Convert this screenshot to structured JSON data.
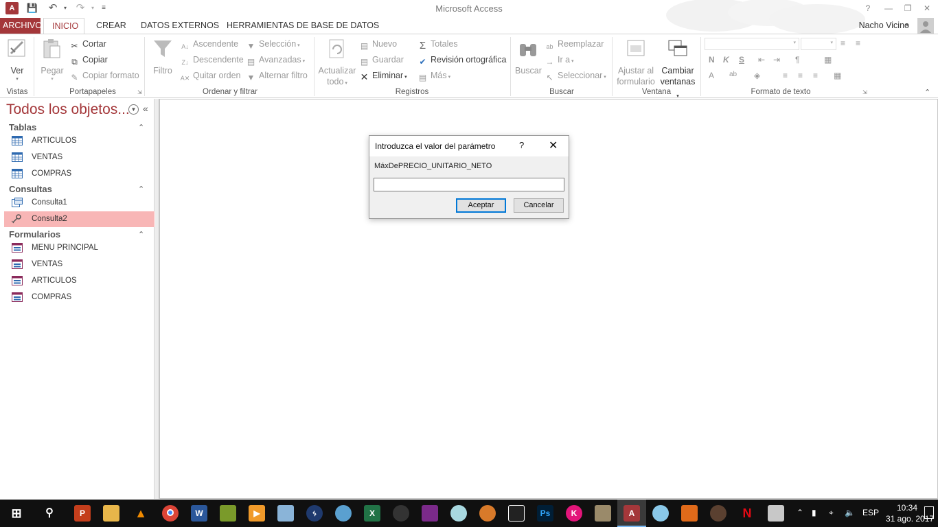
{
  "window": {
    "app_title": "Microsoft Access",
    "help_glyph": "?",
    "user": "Nacho Vicino",
    "app_logo": "A"
  },
  "tabs": [
    {
      "label": "ARCHIVO"
    },
    {
      "label": "INICIO"
    },
    {
      "label": "CREAR"
    },
    {
      "label": "DATOS EXTERNOS"
    },
    {
      "label": "HERRAMIENTAS DE BASE DE DATOS"
    }
  ],
  "ribbon": {
    "vistas": {
      "label": "Vistas",
      "ver": "Ver"
    },
    "portapapeles": {
      "label": "Portapapeles",
      "pegar": "Pegar",
      "cortar": "Cortar",
      "copiar": "Copiar",
      "copiar_formato": "Copiar formato"
    },
    "ordenar": {
      "label": "Ordenar y filtrar",
      "filtro": "Filtro",
      "ascendente": "Ascendente",
      "descendente": "Descendente",
      "quitar_orden": "Quitar orden",
      "seleccion": "Selección",
      "avanzadas": "Avanzadas",
      "alternar_filtro": "Alternar filtro"
    },
    "registros": {
      "label": "Registros",
      "actualizar_1": "Actualizar",
      "actualizar_2": "todo",
      "nuevo": "Nuevo",
      "guardar": "Guardar",
      "eliminar": "Eliminar",
      "totales": "Totales",
      "revision": "Revisión ortográfica",
      "mas": "Más"
    },
    "buscar": {
      "label": "Buscar",
      "buscar": "Buscar",
      "reemplazar": "Reemplazar",
      "ir_a": "Ir a",
      "seleccionar": "Seleccionar"
    },
    "ventana": {
      "label": "Ventana",
      "ajustar_1": "Ajustar al",
      "ajustar_2": "formulario",
      "cambiar_1": "Cambiar",
      "cambiar_2": "ventanas"
    },
    "formato": {
      "label": "Formato de texto",
      "bold": "N",
      "italic": "K",
      "underline": "S"
    }
  },
  "nav": {
    "title": "Todos los objetos...",
    "sections": [
      {
        "label": "Tablas",
        "items": [
          "ARTICULOS",
          "VENTAS",
          "COMPRAS"
        ]
      },
      {
        "label": "Consultas",
        "items": [
          "Consulta1",
          "Consulta2"
        ]
      },
      {
        "label": "Formularios",
        "items": [
          "MENU PRINCIPAL",
          "VENTAS",
          "ARTICULOS",
          "COMPRAS"
        ]
      }
    ],
    "selected_item": "Consulta2"
  },
  "dialog": {
    "title": "Introduzca el valor del parámetro",
    "help": "?",
    "parameter": "MáxDePRECIO_UNITARIO_NETO",
    "input_value": "",
    "ok_label": "Aceptar",
    "cancel_label": "Cancelar"
  },
  "taskbar": {
    "time": "10:34",
    "date": "31 ago. 2017",
    "language": "ESP",
    "apps": [
      "start-icon",
      "search-icon",
      "powerpoint-icon",
      "file-explorer-icon",
      "vlc-icon",
      "chrome-icon",
      "word-icon",
      "app-icon",
      "media-player-icon",
      "app-icon",
      "bluetooth-icon",
      "paint-icon",
      "excel-icon",
      "app-icon",
      "winrar-icon",
      "app-icon",
      "app-icon",
      "app-icon",
      "photoshop-icon",
      "k-icon",
      "app-icon",
      "access-icon",
      "app-icon",
      "app-icon",
      "app-icon",
      "netflix-icon",
      "app-icon"
    ]
  },
  "colors": {
    "accent": "#a4373a",
    "selected_item": "#f8b6b6",
    "taskbar": "#101010",
    "default_button_border": "#0078d7"
  }
}
